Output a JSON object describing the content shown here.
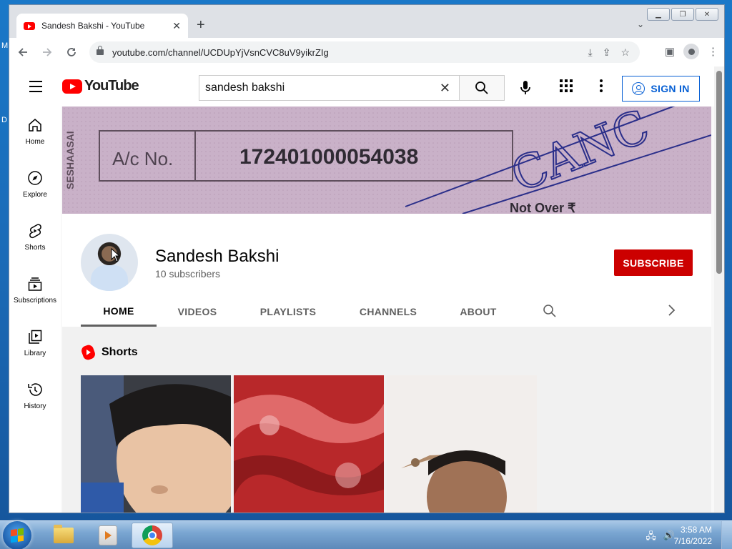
{
  "browser": {
    "tab_title": "Sandesh Bakshi - YouTube",
    "url": "youtube.com/channel/UCDUpYjVsnCVC8uV9yikrZIg",
    "new_tab_symbol": "+",
    "tab_close_symbol": "✕"
  },
  "youtube": {
    "logo_text": "YouTube",
    "search_value": "sandesh bakshi",
    "sign_in_label": "SIGN IN",
    "guide": [
      {
        "label": "Home",
        "icon": "home-icon"
      },
      {
        "label": "Explore",
        "icon": "compass-icon"
      },
      {
        "label": "Shorts",
        "icon": "shorts-icon"
      },
      {
        "label": "Subscriptions",
        "icon": "subscriptions-icon"
      },
      {
        "label": "Library",
        "icon": "library-icon"
      },
      {
        "label": "History",
        "icon": "history-icon"
      }
    ],
    "banner": {
      "label": "A/c No.",
      "account_number": "172401000054038",
      "vertical_text": "SESHAASAI",
      "stamp_text": "CANC",
      "footer_text": "Not Over ₹"
    },
    "channel": {
      "name": "Sandesh Bakshi",
      "subscribers": "10 subscribers",
      "subscribe_label": "SUBSCRIBE"
    },
    "tabs": [
      "HOME",
      "VIDEOS",
      "PLAYLISTS",
      "CHANNELS",
      "ABOUT"
    ],
    "active_tab": "HOME",
    "section_title": "Shorts",
    "accent_color": "#cc0000"
  },
  "taskbar": {
    "time": "3:58 AM",
    "date": "7/16/2022"
  },
  "desktop": {
    "edge_letters": [
      "M",
      "D"
    ]
  }
}
